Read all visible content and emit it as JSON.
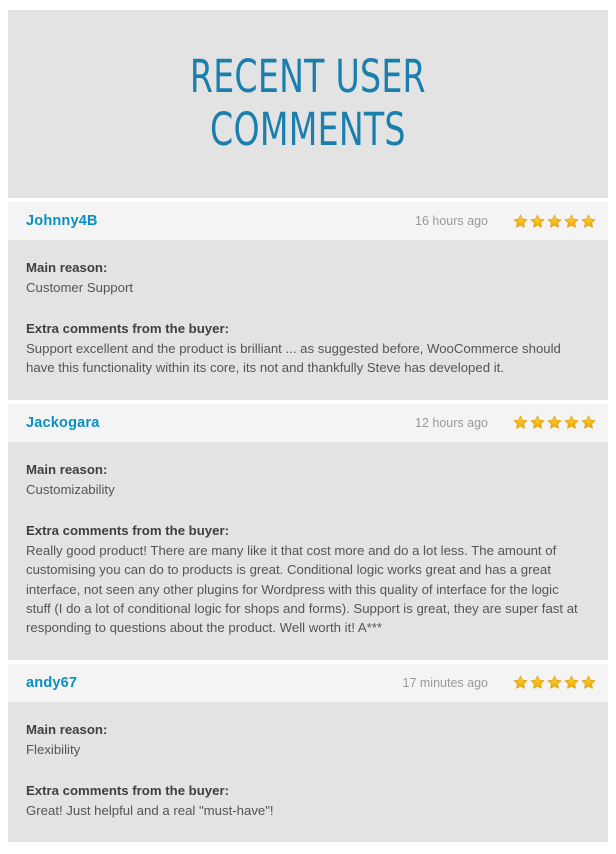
{
  "page": {
    "title": "RECENT USER\nCOMMENTS",
    "accent_color": "#1a7fad",
    "username_color": "#0a8fc4",
    "banner_background": "#e3e3e3",
    "header_background": "#f4f4f4",
    "body_background": "#e3e3e3",
    "star_color": "#f5b912"
  },
  "labels": {
    "main_reason": "Main reason:",
    "extra_comments": "Extra comments from the buyer:"
  },
  "reviews": [
    {
      "username": "Johnny4B",
      "time_ago": "16 hours ago",
      "rating": 5,
      "main_reason": "Customer Support",
      "extra_comments": "Support excellent and the product is brilliant ... as suggested before, WooCommerce should have this functionality within its core, its not and thankfully Steve has developed it."
    },
    {
      "username": "Jackogara",
      "time_ago": "12 hours ago",
      "rating": 5,
      "main_reason": "Customizability",
      "extra_comments": "Really good product! There are many like it that cost more and do a lot less. The amount of customising you can do to products is great. Conditional logic works great and has a great interface, not seen any other plugins for Wordpress with this quality of interface for the logic stuff (I do a lot of conditional logic for shops and forms). Support is great, they are super fast at responding to questions about the product. Well worth it! A***"
    },
    {
      "username": "andy67",
      "time_ago": "17 minutes ago",
      "rating": 5,
      "main_reason": "Flexibility",
      "extra_comments": "Great! Just helpful and a real \"must-have\"!"
    }
  ]
}
